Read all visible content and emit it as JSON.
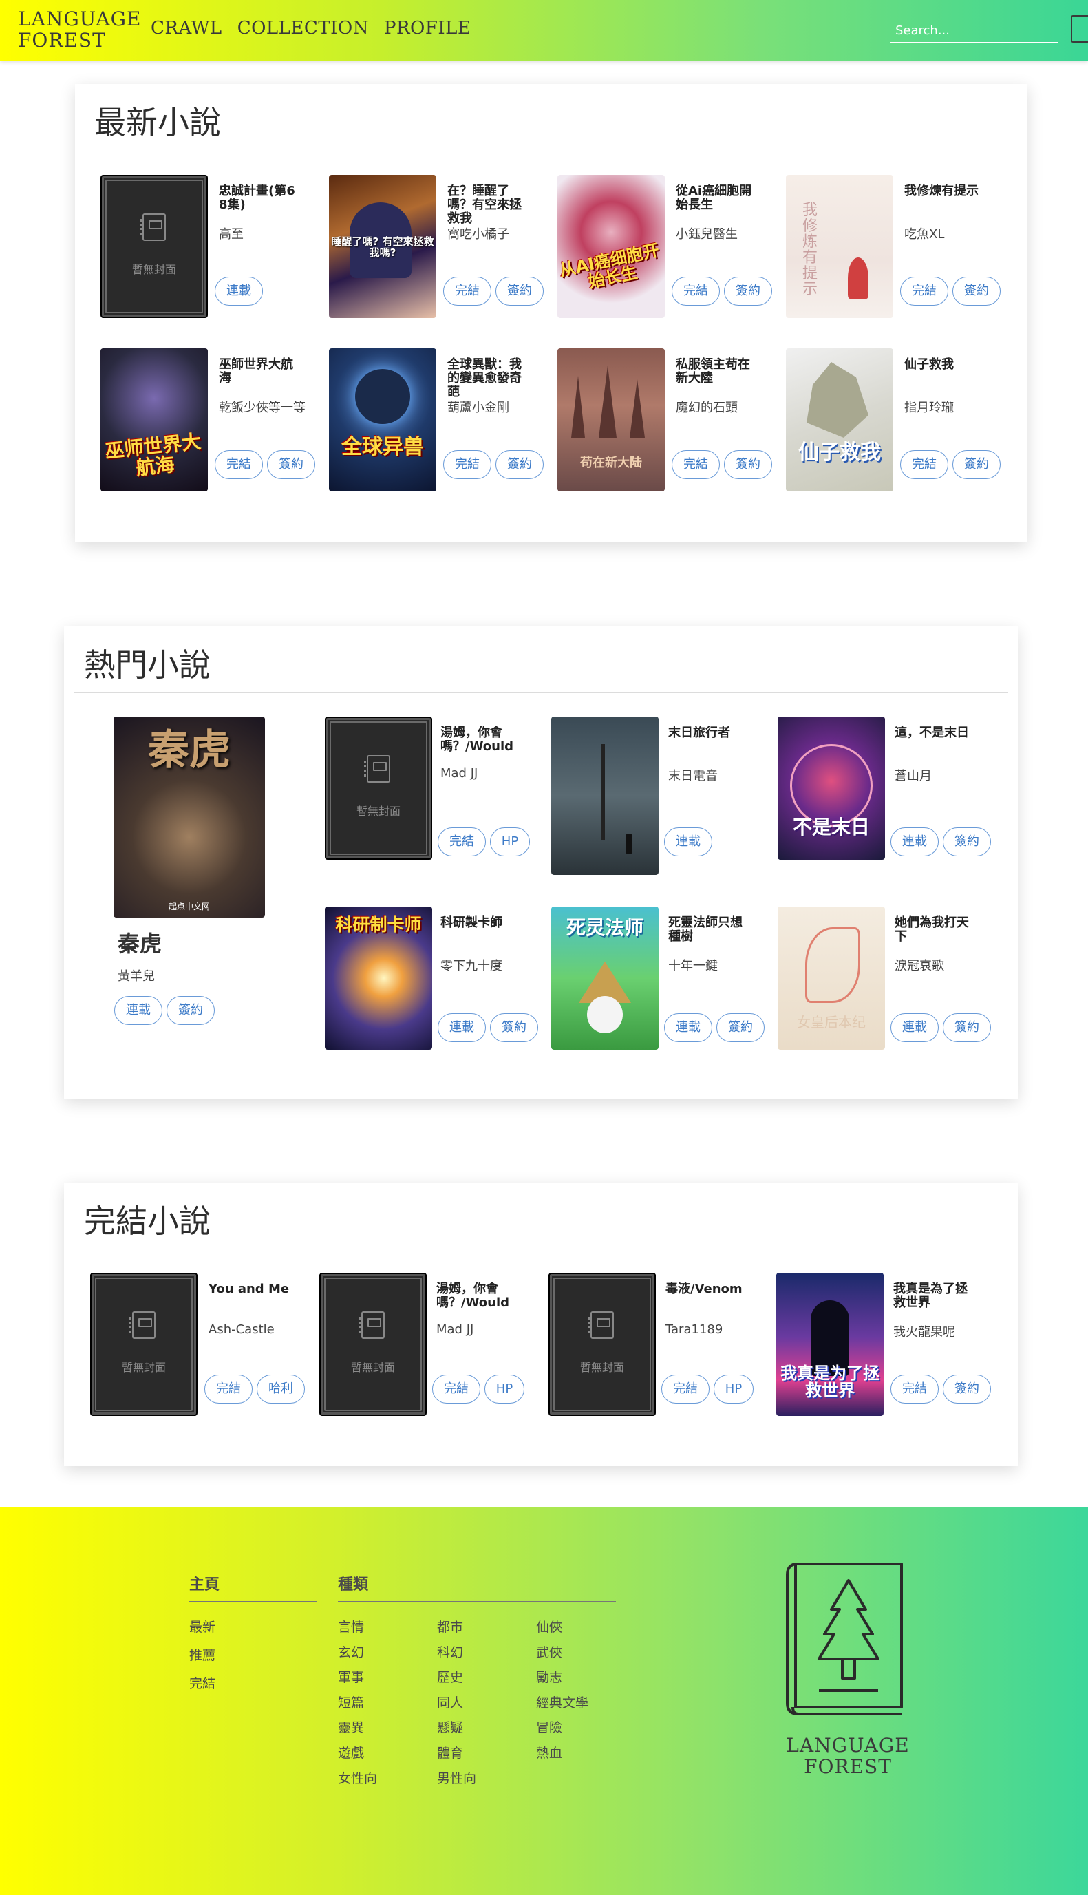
{
  "nav": {
    "brand_line1": "LANGUAGE",
    "brand_line2": "FOREST",
    "links": [
      "CRAWL",
      "COLLECTION",
      "PROFILE"
    ],
    "search_placeholder": "Search..."
  },
  "empty_cover_text": "暫無封面",
  "latest": {
    "title": "最新小說",
    "books": [
      {
        "title": "忠誠計畫(第68集)",
        "author": "高至",
        "tags": [
          "連載"
        ]
      },
      {
        "title": "在？睡醒了嗎？有空來拯救我",
        "author": "窩吃小橘子",
        "tags": [
          "完結",
          "簽約"
        ],
        "cover_text": "睡醒了嗎? 有空來拯救我嗎?"
      },
      {
        "title": "從Ai癌細胞開始長生",
        "author": "小鈺兒醫生",
        "tags": [
          "完結",
          "簽約"
        ],
        "cover_text": "从AI癌细胞开始长生"
      },
      {
        "title": "我修煉有提示",
        "author": "吃魚XL",
        "tags": [
          "完結",
          "簽約"
        ],
        "cover_text": "我修炼有提示"
      },
      {
        "title": "巫師世界大航海",
        "author": "乾飯少俠等一等",
        "tags": [
          "完結",
          "簽約"
        ],
        "cover_text": "巫师世界大航海"
      },
      {
        "title": "全球異獸：我的變異愈發奇葩",
        "author": "葫蘆小金剛",
        "tags": [
          "完結",
          "簽約"
        ],
        "cover_text": "全球异兽"
      },
      {
        "title": "私服領主苟在新大陸",
        "author": "魔幻的石頭",
        "tags": [
          "完結",
          "簽約"
        ],
        "cover_text": "苟在新大陆"
      },
      {
        "title": "仙子救我",
        "author": "指月玲瓏",
        "tags": [
          "完結",
          "簽約"
        ],
        "cover_text": "仙子救我"
      }
    ]
  },
  "popular": {
    "title": "熱門小說",
    "featured": {
      "title": "秦虎",
      "author": "黃羊兒",
      "tags": [
        "連載",
        "簽約"
      ],
      "cover_text": "秦虎",
      "cover_pub": "起点中文网"
    },
    "books": [
      {
        "title": "湯姆，你會嗎？/Would",
        "author": "Mad JJ",
        "tags": [
          "完結",
          "HP"
        ]
      },
      {
        "title": "末日旅行者",
        "author": "末日電音",
        "tags": [
          "連載"
        ]
      },
      {
        "title": "這，不是末日",
        "author": "蒼山月",
        "tags": [
          "連載",
          "簽約"
        ],
        "cover_text": "不是末日"
      },
      {
        "title": "科研製卡師",
        "author": "零下九十度",
        "tags": [
          "連載",
          "簽約"
        ],
        "cover_text": "科研制卡师"
      },
      {
        "title": "死靈法師只想種樹",
        "author": "十年一鍵",
        "tags": [
          "連載",
          "簽約"
        ],
        "cover_text": "死灵法师"
      },
      {
        "title": "她們為我打天下",
        "author": "淚冠哀歌",
        "tags": [
          "連載",
          "簽約"
        ],
        "cover_text": "女皇后本纪"
      }
    ]
  },
  "completed": {
    "title": "完結小說",
    "books": [
      {
        "title": "You and Me",
        "author": "Ash-Castle",
        "tags": [
          "完結",
          "哈利"
        ]
      },
      {
        "title": "湯姆，你會嗎？/Would",
        "author": "Mad JJ",
        "tags": [
          "完結",
          "HP"
        ]
      },
      {
        "title": "毒液/Venom",
        "author": "Tara1189",
        "tags": [
          "完結",
          "HP"
        ]
      },
      {
        "title": "我真是為了拯救世界",
        "author": "我火龍果呢",
        "tags": [
          "完結",
          "簽約"
        ],
        "cover_text": "我真是为了拯救世界"
      }
    ]
  },
  "footer": {
    "main_heading": "主頁",
    "main_links": [
      "最新",
      "推薦",
      "完結"
    ],
    "genre_heading": "種類",
    "genre_col1": [
      "言情",
      "玄幻",
      "軍事",
      "短篇",
      "靈異",
      "遊戲",
      "女性向"
    ],
    "genre_col2": [
      "都市",
      "科幻",
      "歷史",
      "同人",
      "懸疑",
      "體育",
      "男性向"
    ],
    "genre_col3": [
      "仙俠",
      "武俠",
      "勵志",
      "經典文學",
      "冒險",
      "熱血"
    ],
    "logo_line1": "LANGUAGE",
    "logo_line2": "FOREST"
  }
}
